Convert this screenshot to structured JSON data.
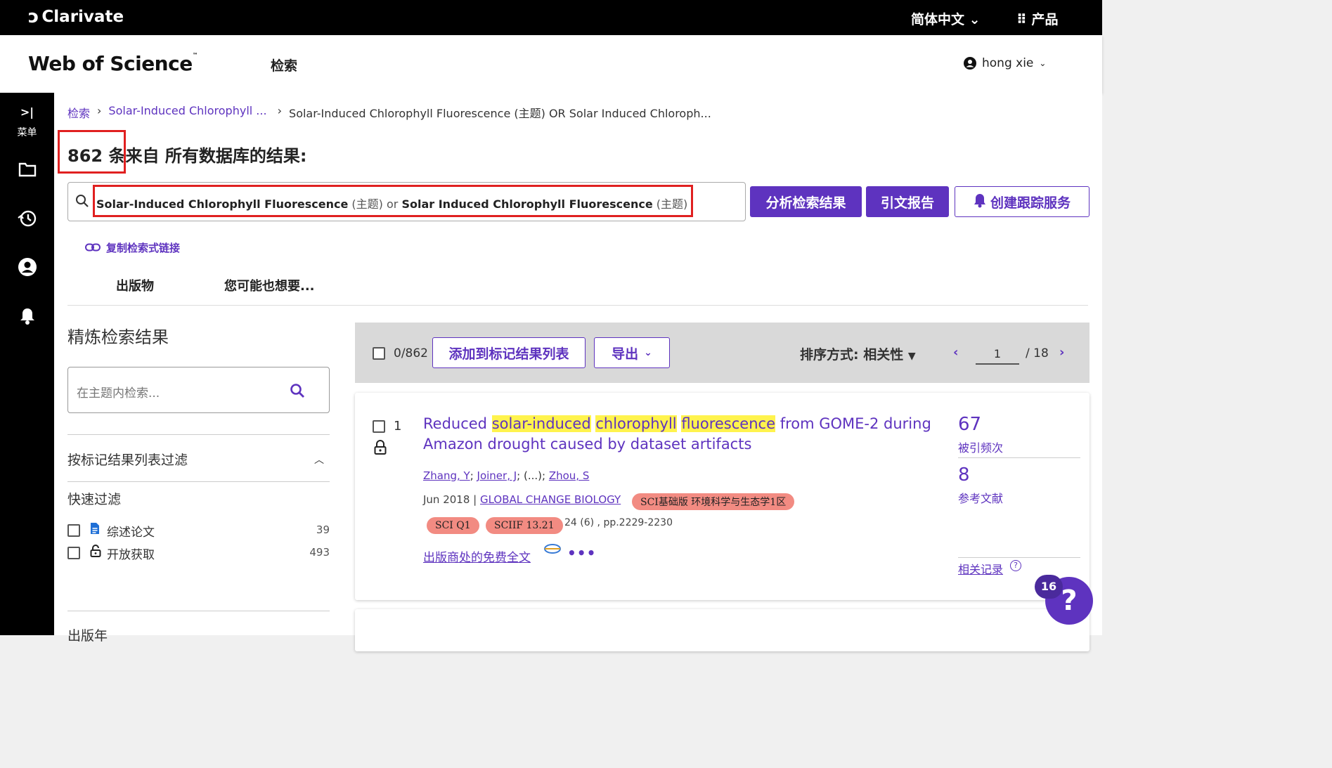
{
  "topbar": {
    "brand": "Clarivate",
    "language": "简体中文 ⌄",
    "products": "产品"
  },
  "header": {
    "logo": "Web of Science",
    "logo_tm": "™",
    "nav_search": "检索",
    "user": "hong xie"
  },
  "sidenav": {
    "menu_label": "菜单"
  },
  "breadcrumb": [
    "检索",
    "Solar-Induced Chlorophyll ...",
    "Solar-Induced Chlorophyll Fluorescence (主题) OR Solar Induced Chloroph..."
  ],
  "results": {
    "count": "862",
    "count_text": "条来自 所有数据库的结果:"
  },
  "query": {
    "term1": "Solar-Induced Chlorophyll Fluorescence",
    "tag1": "(主题)",
    "op": "or",
    "term2": "Solar Induced Chlorophyll Fluorescence",
    "tag2": "(主题)"
  },
  "actions": {
    "analyze": "分析检索结果",
    "citation_report": "引文报告",
    "create_alert": "创建跟踪服务",
    "copy_link": "复制检索式链接"
  },
  "tabs": [
    "出版物",
    "您可能也想要..."
  ],
  "refine": {
    "title": "精炼检索结果",
    "search_placeholder": "在主题内检索...",
    "filter_marked": "按标记结果列表过滤",
    "quick_filter": "快速过滤",
    "filters": [
      {
        "label": "综述论文",
        "count": "39"
      },
      {
        "label": "开放获取",
        "count": "493"
      }
    ],
    "pub_year": "出版年"
  },
  "toolbar": {
    "selected": "0/862",
    "add_to_marked": "添加到标记结果列表",
    "export": "导出",
    "sort": "排序方式: 相关性",
    "page": "1",
    "total_pages": "/ 18"
  },
  "record": {
    "number": "1",
    "title_parts": [
      "Reduced",
      "solar-induced",
      "chlorophyll",
      "fluorescence",
      "from GOME-2 during Amazon drought caused by dataset artifacts"
    ],
    "authors": [
      "Zhang, Y",
      "Joiner, J",
      "(...)",
      "Zhou, S"
    ],
    "date": "Jun 2018",
    "journal": "GLOBAL CHANGE BIOLOGY",
    "badges": {
      "sci_base": "SCI基础版 环境科学与生态学1区",
      "sci_q": "SCI Q1",
      "sciif": "SCIIF 13.21"
    },
    "volume": "24 (6) , pp.2229-2230",
    "fulltext": "出版商处的免费全文",
    "more": "•••",
    "citations": "67",
    "citations_label": "被引频次",
    "references": "8",
    "references_label": "参考文献",
    "related": "相关记录"
  },
  "help": {
    "count": "16",
    "symbol": "?"
  },
  "colors": {
    "accent": "#5e33bf",
    "highlight": "#fff34d",
    "badge": "#f28b82",
    "annotation": "#e02020"
  }
}
